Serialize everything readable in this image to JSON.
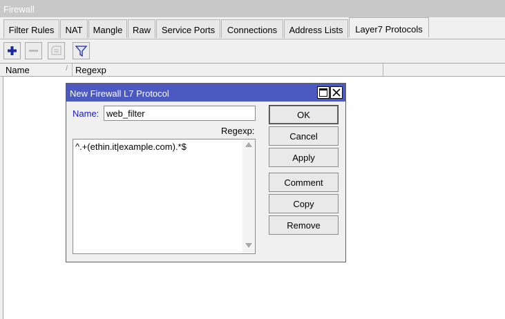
{
  "window": {
    "title": "Firewall"
  },
  "tabs": [
    {
      "label": "Filter Rules"
    },
    {
      "label": "NAT"
    },
    {
      "label": "Mangle"
    },
    {
      "label": "Raw"
    },
    {
      "label": "Service Ports"
    },
    {
      "label": "Connections"
    },
    {
      "label": "Address Lists"
    },
    {
      "label": "Layer7 Protocols"
    }
  ],
  "active_tab": "Layer7 Protocols",
  "toolbar": {
    "add_icon": "plus-icon",
    "remove_icon": "minus-icon",
    "comment_icon": "comment-icon",
    "filter_icon": "filter-icon"
  },
  "table": {
    "columns": [
      {
        "label": "Name",
        "sort_mark": "/"
      },
      {
        "label": "Regexp"
      }
    ]
  },
  "dialog": {
    "title": "New Firewall L7 Protocol",
    "name_label": "Name:",
    "name_value": "web_filter",
    "regexp_label": "Regexp:",
    "regexp_value": "^.+(ethin.it|example.com).*$",
    "buttons": {
      "ok": "OK",
      "cancel": "Cancel",
      "apply": "Apply",
      "comment": "Comment",
      "copy": "Copy",
      "remove": "Remove"
    }
  },
  "colors": {
    "dialog_title_bg": "#4b59c1",
    "name_label": "#1515c8",
    "add_icon": "#1a2a9c"
  }
}
